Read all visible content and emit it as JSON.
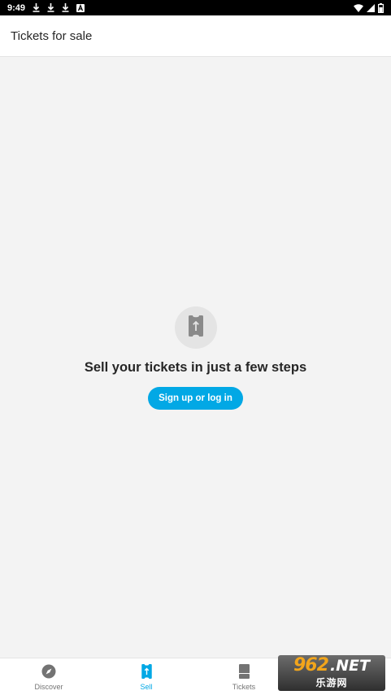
{
  "status_bar": {
    "time": "9:49",
    "icons": [
      "download-icon",
      "download-icon",
      "download-icon",
      "a-box-icon",
      "wifi-icon",
      "signal-icon",
      "battery-icon"
    ]
  },
  "header": {
    "title": "Tickets for sale"
  },
  "empty_state": {
    "icon": "ticket-upload-icon",
    "heading": "Sell your tickets in just a few steps",
    "button_label": "Sign up or log in"
  },
  "bottom_nav": {
    "items": [
      {
        "label": "Discover",
        "icon": "compass-icon",
        "active": false
      },
      {
        "label": "Sell",
        "icon": "ticket-upload-icon",
        "active": true
      },
      {
        "label": "Tickets",
        "icon": "ticket-icon",
        "active": false
      }
    ]
  },
  "watermark": {
    "number": "962",
    "suffix": ".NET",
    "subtitle": "乐游网"
  },
  "colors": {
    "accent": "#02a8e5",
    "background": "#f3f3f3",
    "text_primary": "#262626",
    "nav_inactive": "#737373",
    "icon_circle": "#e4e4e4"
  }
}
